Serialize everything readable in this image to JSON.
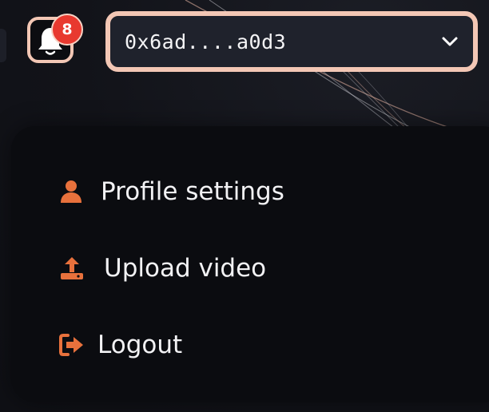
{
  "header": {
    "notifications": {
      "count": "8",
      "icon": "bell-icon"
    },
    "wallet": {
      "address": "0x6ad....a0d3",
      "dropdown_icon": "chevron-down-icon"
    }
  },
  "menu": {
    "items": [
      {
        "label": "Profile settings",
        "icon": "user-icon"
      },
      {
        "label": "Upload video",
        "icon": "upload-icon"
      },
      {
        "label": "Logout",
        "icon": "logout-icon"
      }
    ]
  },
  "colors": {
    "accent": "#e8713c",
    "badge": "#e8392f",
    "border": "#f3c7b5",
    "background": "#111319",
    "panel": "#0b0c10"
  }
}
